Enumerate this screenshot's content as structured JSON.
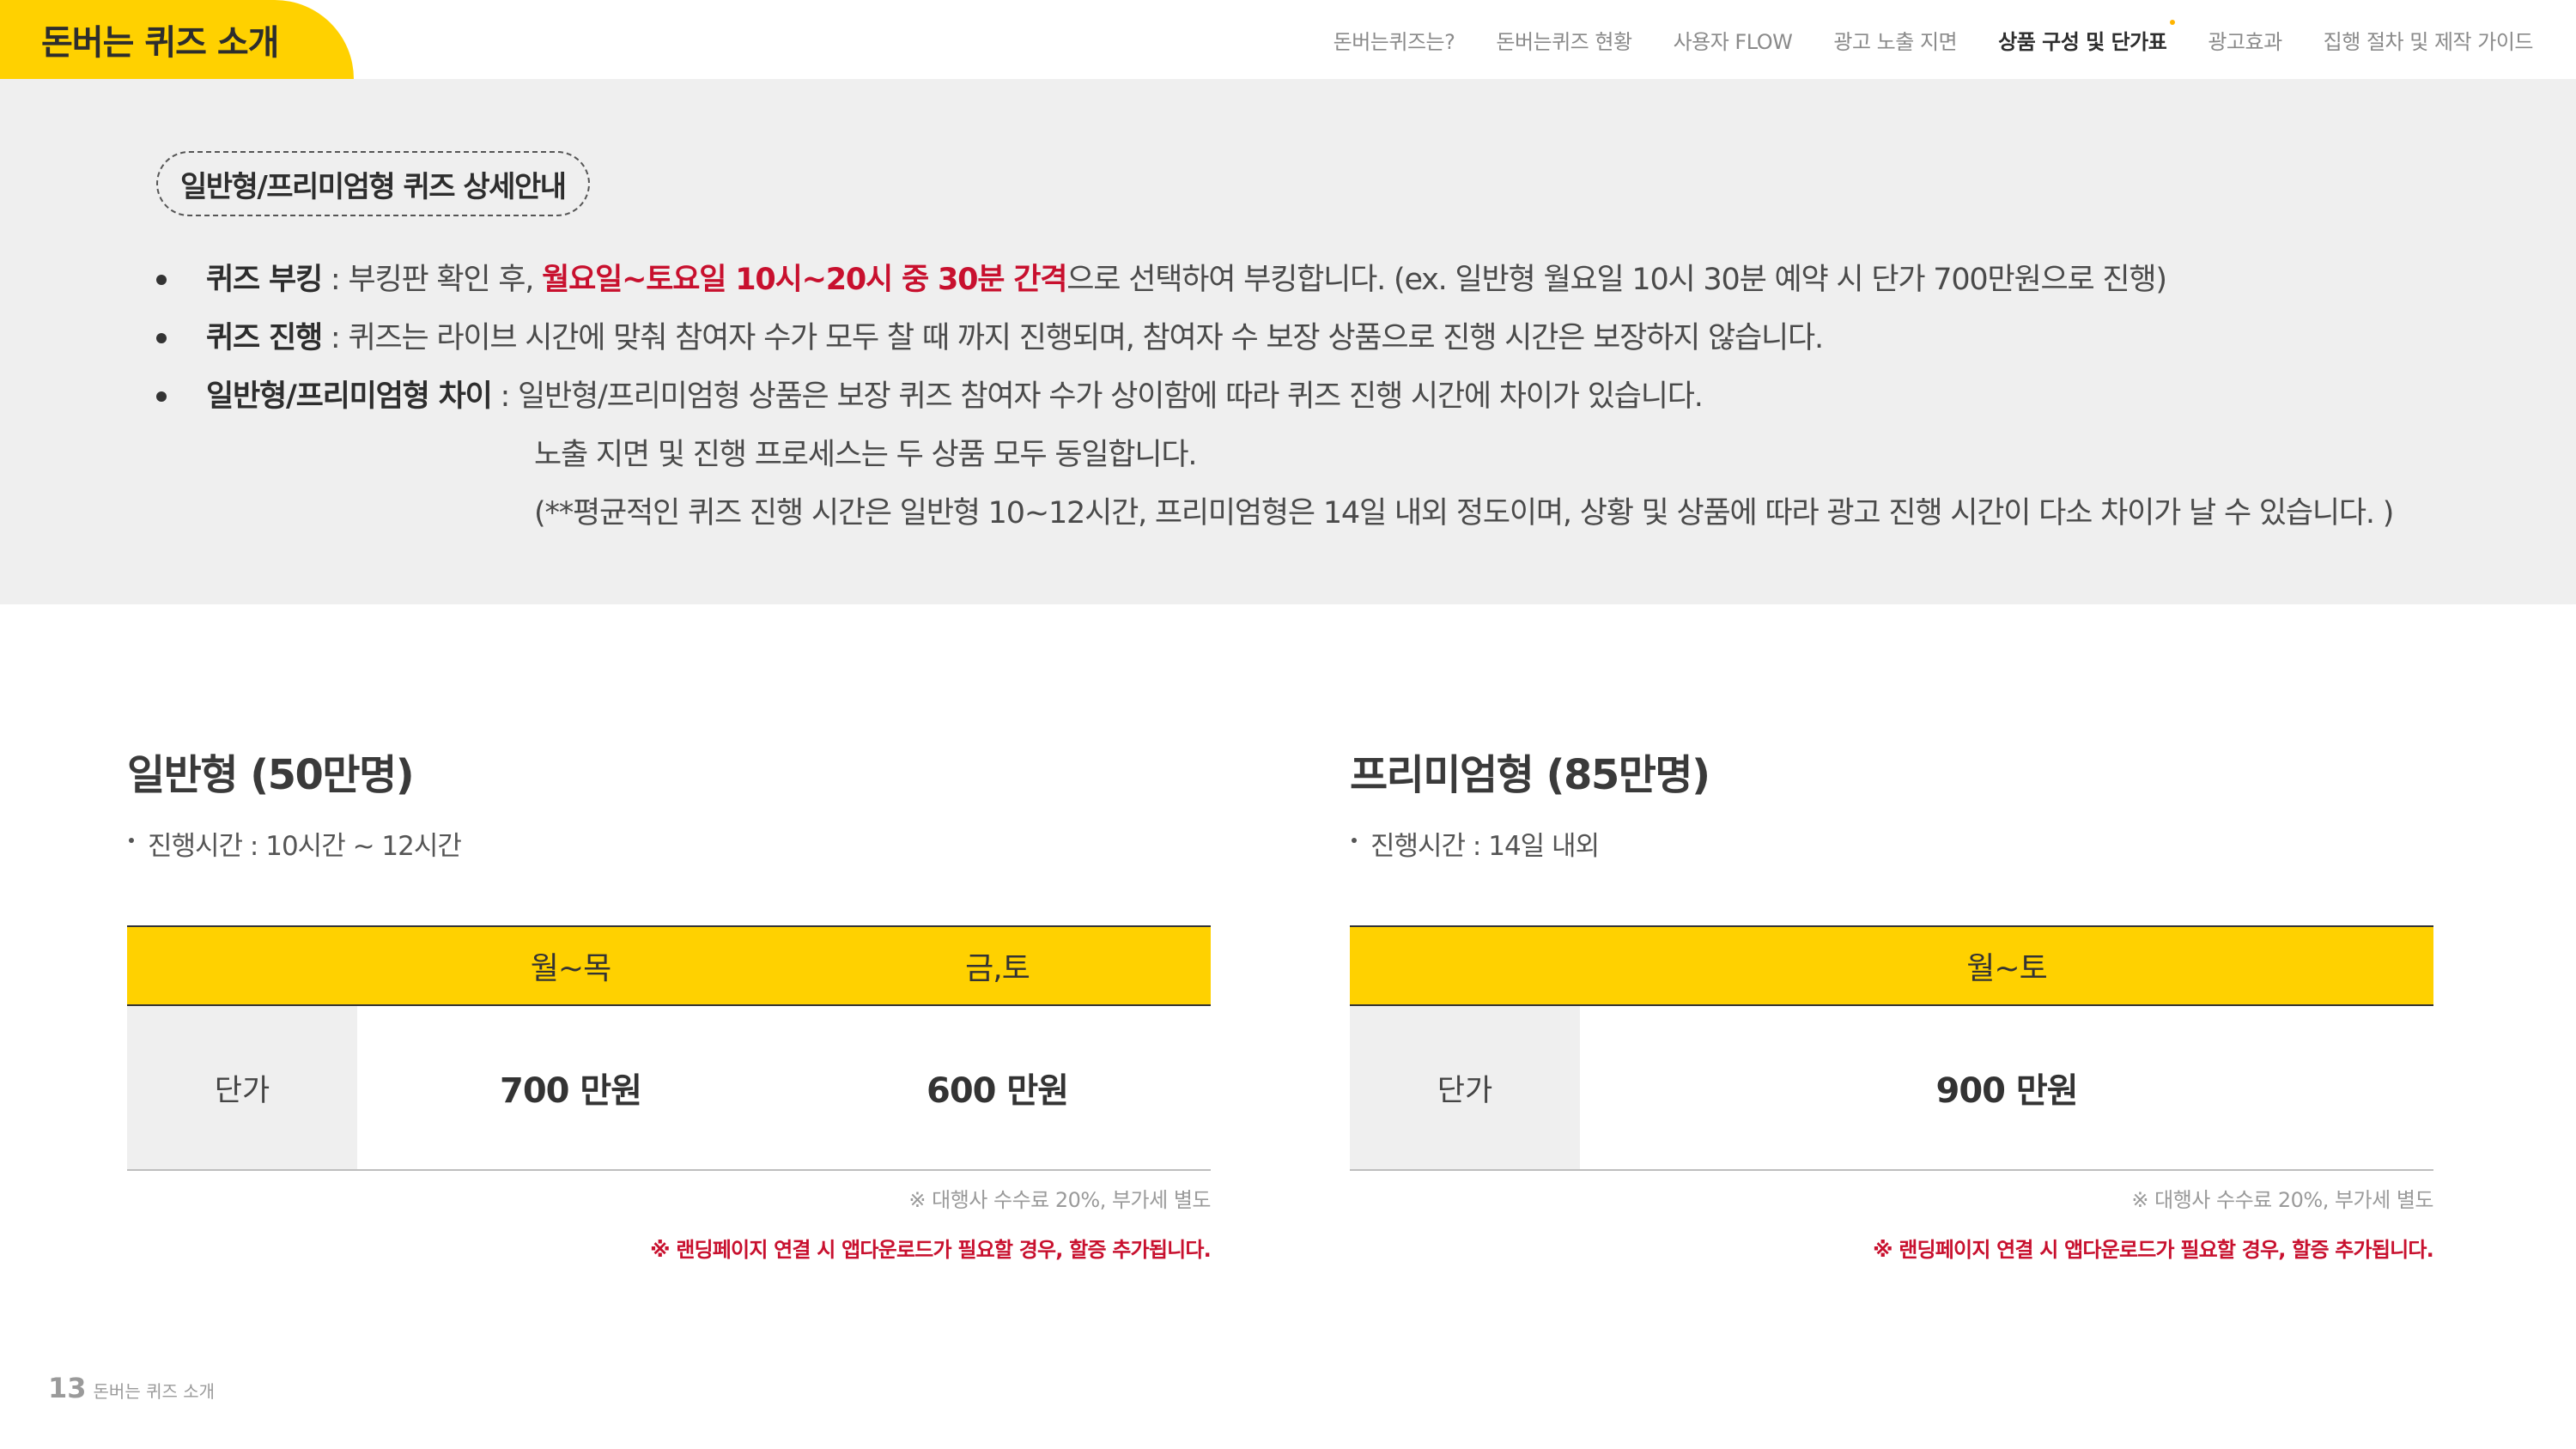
{
  "header": {
    "brand": "돈버는 퀴즈 소개",
    "nav": [
      {
        "label": "돈버는퀴즈는?",
        "active": false
      },
      {
        "label": "돈버는퀴즈 현황",
        "active": false
      },
      {
        "label": "사용자 FLOW",
        "active": false
      },
      {
        "label": "광고 노출 지면",
        "active": false
      },
      {
        "label": "상품 구성 및 단가표",
        "active": true
      },
      {
        "label": "광고효과",
        "active": false
      },
      {
        "label": "집행 절차 및 제작 가이드",
        "active": false
      }
    ]
  },
  "info": {
    "pill": "일반형/프리미엄형 퀴즈 상세안내",
    "booking": {
      "label": "퀴즈 부킹",
      "pre": " : 부킹판 확인 후, ",
      "highlight": "월요일~토요일 10시~20시 중 30분 간격",
      "post": "으로 선택하여 부킹합니다. (ex. 일반형 월요일 10시 30분 예약 시 단가 700만원으로 진행)"
    },
    "progress": {
      "label": "퀴즈 진행",
      "text": " : 퀴즈는 라이브 시간에 맞춰 참여자 수가 모두 찰 때 까지 진행되며, 참여자 수 보장 상품으로 진행 시간은 보장하지 않습니다."
    },
    "diff": {
      "label": "일반형/프리미엄형 차이",
      "text": " : 일반형/프리미엄형 상품은 보장 퀴즈 참여자 수가 상이함에 따라 퀴즈 진행 시간에 차이가 있습니다.",
      "line2": "노출 지면 및 진행 프로세스는 두 상품 모두 동일합니다.",
      "line3": "(**평균적인 퀴즈 진행 시간은  일반형 10~12시간, 프리미엄형은 14일 내외 정도이며, 상황 및 상품에 따라 광고 진행 시간이 다소 차이가 날 수 있습니다. )"
    }
  },
  "basic": {
    "title": "일반형 (50만명)",
    "duration": "진행시간 : 10시간 ~ 12시간",
    "headers": [
      "월~목",
      "금,토"
    ],
    "row_label": "단가",
    "prices": [
      "700 만원",
      "600 만원"
    ],
    "note_fee": "※ 대행사 수수료 20%, 부가세 별도",
    "note_landing": "※ 랜딩페이지 연결 시 앱다운로드가 필요할 경우, 할증 추가됩니다."
  },
  "premium": {
    "title": "프리미엄형 (85만명)",
    "duration": "진행시간 : 14일 내외",
    "headers": [
      "월~토"
    ],
    "row_label": "단가",
    "prices": [
      "900 만원"
    ],
    "note_fee": "※ 대행사 수수료 20%, 부가세 별도",
    "note_landing": "※ 랜딩페이지 연결 시 앱다운로드가 필요할 경우, 할증 추가됩니다."
  },
  "footer": {
    "page_number": "13",
    "text": "돈버는 퀴즈 소개"
  }
}
